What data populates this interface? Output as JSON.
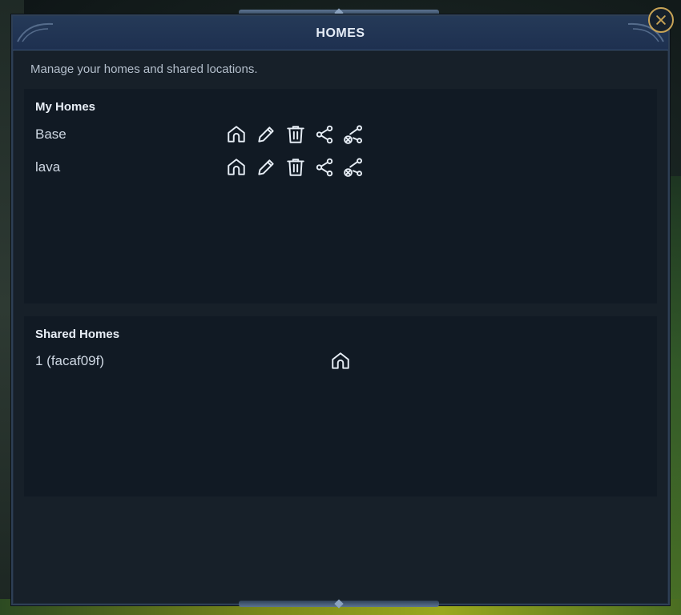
{
  "window": {
    "title": "HOMES",
    "subtitle": "Manage your homes and shared locations."
  },
  "my_homes": {
    "title": "My Homes",
    "items": [
      {
        "name": "Base"
      },
      {
        "name": "lava"
      }
    ],
    "actions": [
      "home-icon",
      "pencil-icon",
      "trash-icon",
      "share-icon",
      "unshare-icon"
    ]
  },
  "shared_homes": {
    "title": "Shared Homes",
    "items": [
      {
        "name": "1 (facaf09f)"
      }
    ],
    "actions": [
      "home-icon"
    ]
  },
  "colors": {
    "panel_bg": "#111a24",
    "window_bg": "#172029",
    "titlebar": "#1e3050",
    "close_ring": "#c9a456",
    "text": "#cfd8e3"
  }
}
